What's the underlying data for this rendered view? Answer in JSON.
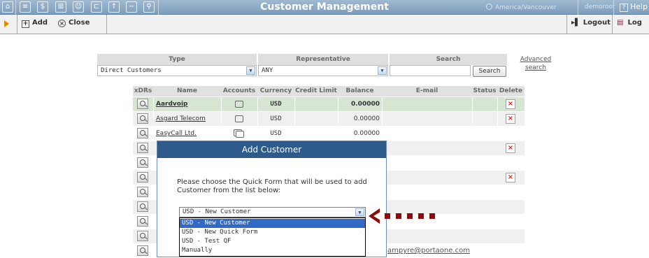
{
  "window": {
    "title": "Customer Management",
    "timezone": "America/Vancouver",
    "user": "demoroot",
    "help_label": "Help"
  },
  "topbar_icons": [
    "home-icon",
    "list-icon",
    "dollar-icon",
    "grid-icon",
    "person-icon",
    "tree-icon",
    "upload-icon",
    "chart-icon",
    "search-icon"
  ],
  "toolbar": {
    "add_label": "Add",
    "close_label": "Close",
    "logout_label": "Logout",
    "log_label": "Log"
  },
  "filters": {
    "type_header": "Type",
    "rep_header": "Representative",
    "search_header": "Search",
    "type_value": "Direct Customers",
    "rep_value": "ANY",
    "search_value": "",
    "search_button": "Search",
    "advanced_line1": "Advanced",
    "advanced_line2": "search"
  },
  "table": {
    "headers": [
      "xDRs",
      "Name",
      "Accounts",
      "Currency",
      "Credit Limit",
      "Balance",
      "E-mail",
      "Status",
      "Delete"
    ],
    "rows": [
      {
        "name": "Aardvoip",
        "currency": "USD",
        "balance": "0.00000"
      },
      {
        "name": "Asgard Telecom",
        "currency": "USD",
        "balance": "0.00000"
      },
      {
        "name": "EasyCall Ltd.",
        "currency": "USD",
        "balance": "0.00000"
      }
    ],
    "partial_email": "ampyre@portaone.com"
  },
  "dialog": {
    "title": "Add Customer",
    "message": "Please choose the Quick Form that will be used to add Customer from the list below:",
    "selected": "USD - New Customer",
    "options": [
      "USD - New Customer",
      "USD - New Quick Form",
      "USD - Test QF",
      "Manually"
    ]
  },
  "colors": {
    "header_bg": "#8fabc7",
    "dialog_title": "#2e5b8a",
    "selection": "#316ac5",
    "arrow": "#8b0a0a",
    "row_highlight": "#d6e6d3"
  }
}
